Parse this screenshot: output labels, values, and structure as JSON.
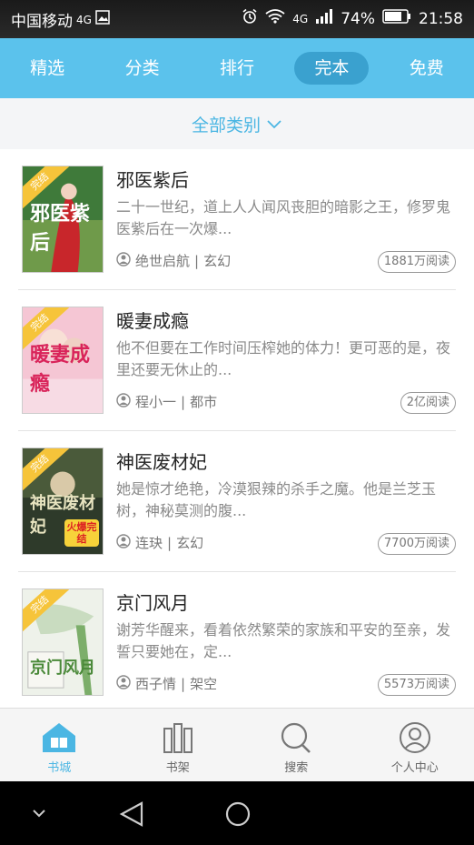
{
  "status": {
    "carrier": "中国移动",
    "network": "4G",
    "network_small": "4G",
    "battery": "74%",
    "time": "21:58"
  },
  "tabs": [
    {
      "label": "精选",
      "active": false
    },
    {
      "label": "分类",
      "active": false
    },
    {
      "label": "排行",
      "active": false
    },
    {
      "label": "完本",
      "active": true
    },
    {
      "label": "免费",
      "active": false
    }
  ],
  "category_filter": {
    "label": "全部类别"
  },
  "books": [
    {
      "title": "邪医紫后",
      "desc": "二十一世纪，道上人人闻风丧胆的暗影之王，修罗鬼医紫后在一次爆...",
      "author": "绝世启航",
      "genre": "玄幻",
      "reads": "1881万阅读",
      "ribbon": "完结",
      "cover_text": "邪医紫后"
    },
    {
      "title": "暖妻成瘾",
      "desc": "他不但要在工作时间压榨她的体力！更可恶的是，夜里还要无休止的...",
      "author": "程小一",
      "genre": "都市",
      "reads": "2亿阅读",
      "ribbon": "完结",
      "cover_text": "暖妻成瘾"
    },
    {
      "title": "神医废材妃",
      "desc": "她是惊才绝艳，冷漠狠辣的杀手之魔。他是兰芝玉树，神秘莫测的腹...",
      "author": "连玦",
      "genre": "玄幻",
      "reads": "7700万阅读",
      "ribbon": "完结",
      "cover_text": "神医废材妃",
      "cover_badge": "火爆完结"
    },
    {
      "title": "京门风月",
      "desc": "谢芳华醒来，看着依然繁荣的家族和平安的至亲，发誓只要她在，定...",
      "author": "西子情",
      "genre": "架空",
      "reads": "5573万阅读",
      "ribbon": "完结",
      "cover_text": "京门风月"
    }
  ],
  "bottom_nav": [
    {
      "label": "书城",
      "icon": "bookstore-icon",
      "active": true
    },
    {
      "label": "书架",
      "icon": "bookshelf-icon",
      "active": false
    },
    {
      "label": "搜索",
      "icon": "search-icon",
      "active": false
    },
    {
      "label": "个人中心",
      "icon": "user-center-icon",
      "active": false
    }
  ],
  "colors": {
    "accent": "#5bc2ec",
    "accent_dark": "#3aa1cf",
    "ribbon": "#f6c43a",
    "text_muted": "#8a8a8a"
  }
}
